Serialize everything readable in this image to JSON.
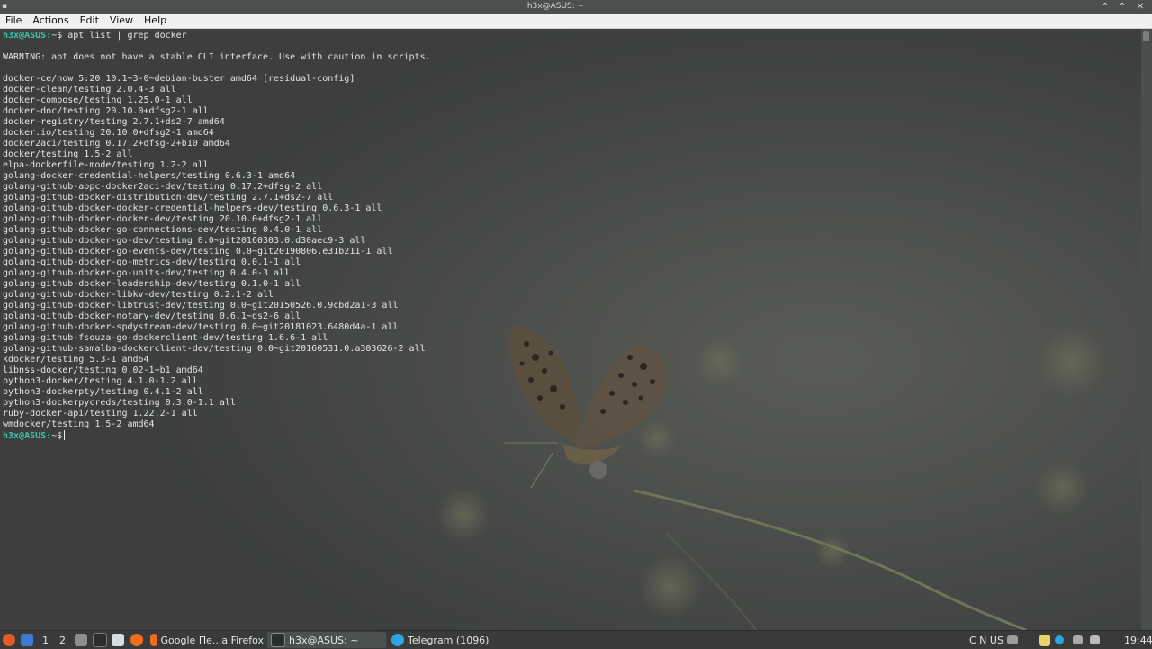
{
  "window": {
    "title": "h3x@ASUS: ~",
    "app_icon": "terminal-icon",
    "buttons": [
      "minimize",
      "maximize",
      "close"
    ]
  },
  "menu": [
    "File",
    "Actions",
    "Edit",
    "View",
    "Help"
  ],
  "terminal": {
    "prompt": "h3x@ASUS:",
    "prompt_tail": "~$",
    "command": " apt list | grep docker",
    "output": [
      "",
      "WARNING: apt does not have a stable CLI interface. Use with caution in scripts.",
      "",
      "docker-ce/now 5:20.10.1~3-0~debian-buster amd64 [residual-config]",
      "docker-clean/testing 2.0.4-3 all",
      "docker-compose/testing 1.25.0-1 all",
      "docker-doc/testing 20.10.0+dfsg2-1 all",
      "docker-registry/testing 2.7.1+ds2-7 amd64",
      "docker.io/testing 20.10.0+dfsg2-1 amd64",
      "docker2aci/testing 0.17.2+dfsg-2+b10 amd64",
      "docker/testing 1.5-2 all",
      "elpa-dockerfile-mode/testing 1.2-2 all",
      "golang-docker-credential-helpers/testing 0.6.3-1 amd64",
      "golang-github-appc-docker2aci-dev/testing 0.17.2+dfsg-2 all",
      "golang-github-docker-distribution-dev/testing 2.7.1+ds2-7 all",
      "golang-github-docker-docker-credential-helpers-dev/testing 0.6.3-1 all",
      "golang-github-docker-docker-dev/testing 20.10.0+dfsg2-1 all",
      "golang-github-docker-go-connections-dev/testing 0.4.0-1 all",
      "golang-github-docker-go-dev/testing 0.0~git20160303.0.d30aec9-3 all",
      "golang-github-docker-go-events-dev/testing 0.0~git20190806.e31b211-1 all",
      "golang-github-docker-go-metrics-dev/testing 0.0.1-1 all",
      "golang-github-docker-go-units-dev/testing 0.4.0-3 all",
      "golang-github-docker-leadership-dev/testing 0.1.0-1 all",
      "golang-github-docker-libkv-dev/testing 0.2.1-2 all",
      "golang-github-docker-libtrust-dev/testing 0.0~git20150526.0.9cbd2a1-3 all",
      "golang-github-docker-notary-dev/testing 0.6.1~ds2-6 all",
      "golang-github-docker-spdystream-dev/testing 0.0~git20181023.6480d4a-1 all",
      "golang-github-fsouza-go-dockerclient-dev/testing 1.6.6-1 all",
      "golang-github-samalba-dockerclient-dev/testing 0.0~git20160531.0.a303626-2 all",
      "kdocker/testing 5.3-1 amd64",
      "libnss-docker/testing 0.02-1+b1 amd64",
      "python3-docker/testing 4.1.0-1.2 all",
      "python3-dockerpty/testing 0.4.1-2 all",
      "python3-dockerpycreds/testing 0.3.0-1.1 all",
      "ruby-docker-api/testing 1.22.2-1 all",
      "wmdocker/testing 1.5-2 amd64"
    ],
    "final_prompt": "h3x@ASUS:",
    "final_prompt_tail": "~$"
  },
  "taskbar": {
    "desktops": [
      "1",
      "2"
    ],
    "tasks": [
      {
        "label": "Google Пе...a Firefox",
        "icon": "firefox-icon"
      },
      {
        "label": "h3x@ASUS: ~",
        "icon": "terminal-icon",
        "active": true
      },
      {
        "label": "Telegram (1096)",
        "icon": "telegram-icon"
      }
    ],
    "keyboard_layout": "C N US",
    "clock": "19:44"
  },
  "colors": {
    "prompt": "#3ec5ad",
    "terminal_text": "#e4e4e4",
    "taskbar": "#383b3a"
  }
}
